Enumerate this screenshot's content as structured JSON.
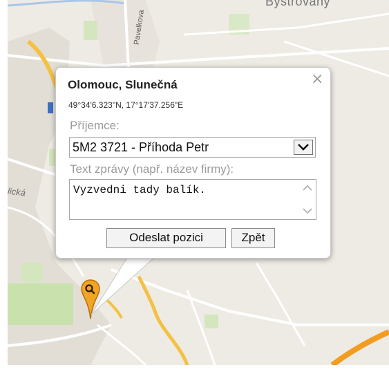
{
  "map": {
    "labels": {
      "top_town": "Bystrovany",
      "street_pavelkova": "Pavelkova",
      "street_partial": "lická"
    },
    "colors": {
      "background": "#eeebe4",
      "highway": "#f4b640",
      "motorway": "#f39c1f",
      "park": "#cbe3b0",
      "water": "#a8c6e8"
    },
    "marker_icon": "search-marker-icon"
  },
  "popup": {
    "title": "Olomouc, Slunečná",
    "coordinates": "49°34'6.323\"N, 17°17'37.256\"E",
    "close_icon": "close-icon",
    "recipient_label": "Příjemce:",
    "recipient_selected": "5M2 3721 - Příhoda Petr",
    "message_label": "Text zprávy (např. název firmy):",
    "message_value": "Vyzvedni tady balík.",
    "send_button": "Odeslat pozici",
    "back_button": "Zpět"
  }
}
